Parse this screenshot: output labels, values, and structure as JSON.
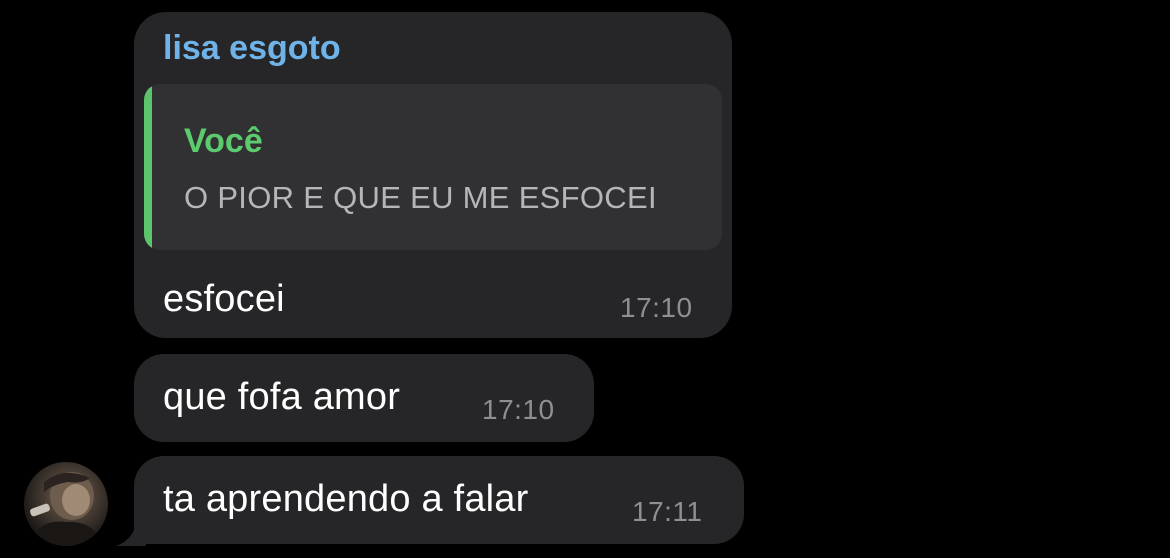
{
  "messages": [
    {
      "sender": "lisa esgoto",
      "reply": {
        "author": "Você",
        "text": "O PIOR E QUE EU ME ESFOCEI"
      },
      "text": "esfocei",
      "time": "17:10"
    },
    {
      "text": "que fofa amor",
      "time": "17:10"
    },
    {
      "text": "ta aprendendo a falar",
      "time": "17:11"
    }
  ],
  "colors": {
    "background": "#000000",
    "bubble": "#262628",
    "sender_name": "#6fb3e8",
    "reply_accent": "#5ccb6e",
    "timestamp": "#8e8e93"
  },
  "icons": {
    "avatar": "contact-avatar"
  }
}
